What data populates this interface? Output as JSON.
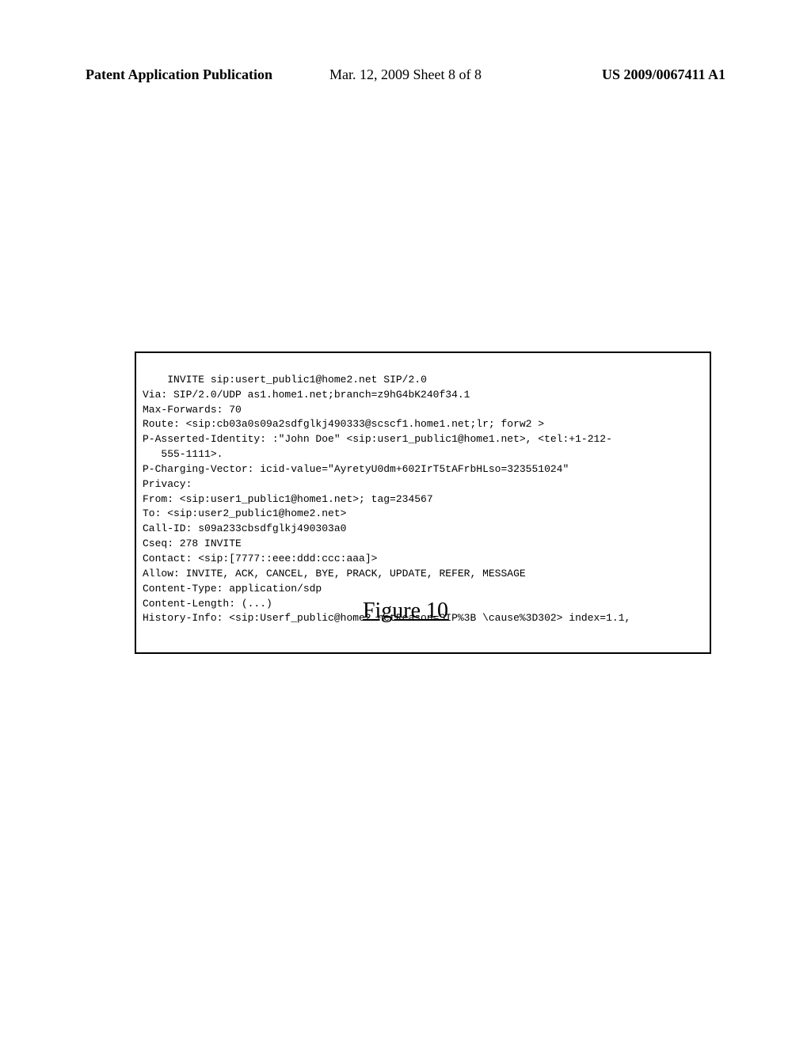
{
  "header": {
    "left": "Patent Application Publication",
    "middle": "Mar. 12, 2009  Sheet 8 of 8",
    "right": "US 2009/0067411 A1"
  },
  "sip_message": "INVITE sip:usert_public1@home2.net SIP/2.0\nVia: SIP/2.0/UDP as1.home1.net;branch=z9hG4bK240f34.1\nMax-Forwards: 70\nRoute: <sip:cb03a0s09a2sdfglkj490333@scscf1.home1.net;lr; forw2 >\nP-Asserted-Identity: :\"John Doe\" <sip:user1_public1@home1.net>, <tel:+1-212-\n   555-1111>.\nP-Charging-Vector: icid-value=\"AyretyU0dm+602IrT5tAFrbHLso=323551024\"\nPrivacy:\nFrom: <sip:user1_public1@home1.net>; tag=234567\nTo: <sip:user2_public1@home2.net>\nCall-ID: s09a233cbsdfglkj490303a0\nCseq: 278 INVITE\nContact: <sip:[7777::eee:ddd:ccc:aaa]>\nAllow: INVITE, ACK, CANCEL, BYE, PRACK, UPDATE, REFER, MESSAGE\nContent-Type: application/sdp\nContent-Length: (...)\nHistory-Info: <sip:Userf_public@home2.netReason=SIP%3B \\cause%3D302> index=1.1,",
  "figure_label": "Figure 10"
}
